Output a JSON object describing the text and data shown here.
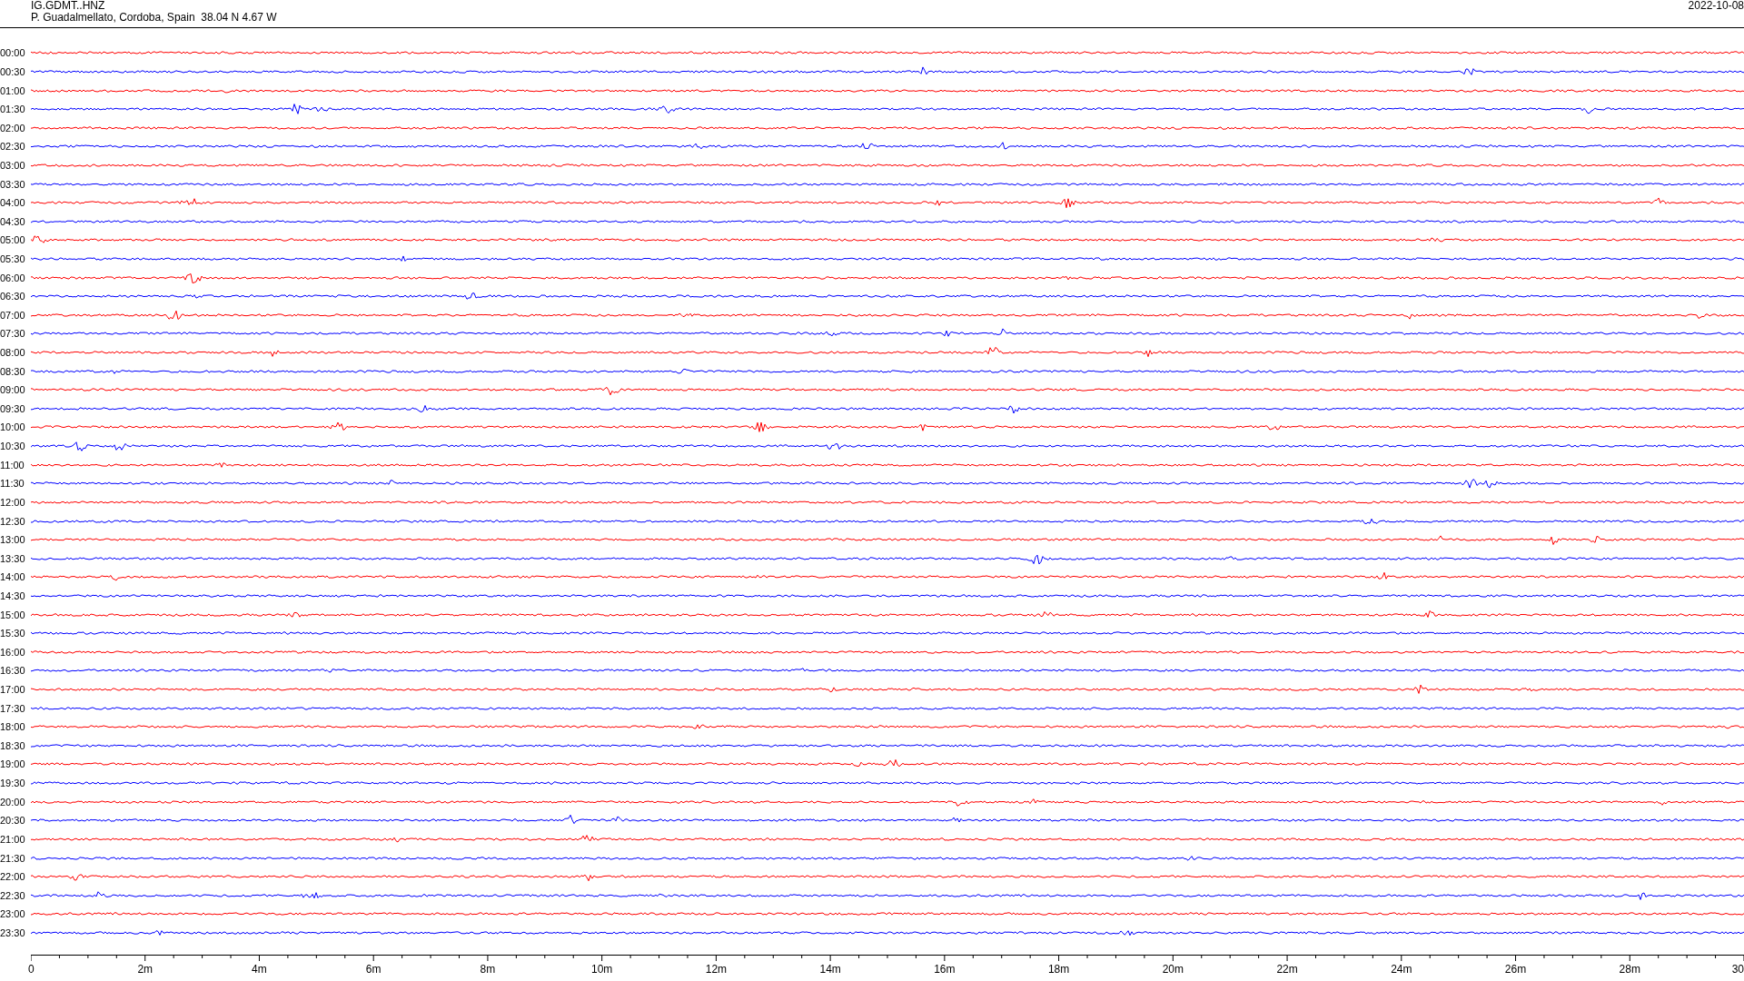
{
  "header": {
    "station": "IG.GDMT..HNZ",
    "location": "P. Guadalmellato, Cordoba, Spain  38.04 N 4.67 W",
    "date": "2022-10-08"
  },
  "rows": [
    {
      "time": "00:00",
      "color": "#ff0000"
    },
    {
      "time": "00:30",
      "color": "#0000ff"
    },
    {
      "time": "01:00",
      "color": "#ff0000"
    },
    {
      "time": "01:30",
      "color": "#0000ff"
    },
    {
      "time": "02:00",
      "color": "#ff0000"
    },
    {
      "time": "02:30",
      "color": "#0000ff"
    },
    {
      "time": "03:00",
      "color": "#ff0000"
    },
    {
      "time": "03:30",
      "color": "#0000ff"
    },
    {
      "time": "04:00",
      "color": "#ff0000"
    },
    {
      "time": "04:30",
      "color": "#0000ff"
    },
    {
      "time": "05:00",
      "color": "#ff0000"
    },
    {
      "time": "05:30",
      "color": "#0000ff"
    },
    {
      "time": "06:00",
      "color": "#ff0000"
    },
    {
      "time": "06:30",
      "color": "#0000ff"
    },
    {
      "time": "07:00",
      "color": "#ff0000"
    },
    {
      "time": "07:30",
      "color": "#0000ff"
    },
    {
      "time": "08:00",
      "color": "#ff0000"
    },
    {
      "time": "08:30",
      "color": "#0000ff"
    },
    {
      "time": "09:00",
      "color": "#ff0000"
    },
    {
      "time": "09:30",
      "color": "#0000ff"
    },
    {
      "time": "10:00",
      "color": "#ff0000"
    },
    {
      "time": "10:30",
      "color": "#0000ff"
    },
    {
      "time": "11:00",
      "color": "#ff0000"
    },
    {
      "time": "11:30",
      "color": "#0000ff"
    },
    {
      "time": "12:00",
      "color": "#ff0000"
    },
    {
      "time": "12:30",
      "color": "#0000ff"
    },
    {
      "time": "13:00",
      "color": "#ff0000"
    },
    {
      "time": "13:30",
      "color": "#0000ff"
    },
    {
      "time": "14:00",
      "color": "#ff0000"
    },
    {
      "time": "14:30",
      "color": "#0000ff"
    },
    {
      "time": "15:00",
      "color": "#ff0000"
    },
    {
      "time": "15:30",
      "color": "#0000ff"
    },
    {
      "time": "16:00",
      "color": "#ff0000"
    },
    {
      "time": "16:30",
      "color": "#0000ff"
    },
    {
      "time": "17:00",
      "color": "#ff0000"
    },
    {
      "time": "17:30",
      "color": "#0000ff"
    },
    {
      "time": "18:00",
      "color": "#ff0000"
    },
    {
      "time": "18:30",
      "color": "#0000ff"
    },
    {
      "time": "19:00",
      "color": "#ff0000"
    },
    {
      "time": "19:30",
      "color": "#0000ff"
    },
    {
      "time": "20:00",
      "color": "#ff0000"
    },
    {
      "time": "20:30",
      "color": "#0000ff"
    },
    {
      "time": "21:00",
      "color": "#ff0000"
    },
    {
      "time": "21:30",
      "color": "#0000ff"
    },
    {
      "time": "22:00",
      "color": "#ff0000"
    },
    {
      "time": "22:30",
      "color": "#0000ff"
    },
    {
      "time": "23:00",
      "color": "#ff0000"
    },
    {
      "time": "23:30",
      "color": "#0000ff"
    }
  ],
  "x_axis": {
    "labels": [
      "0",
      "2m",
      "4m",
      "6m",
      "8m",
      "10m",
      "12m",
      "14m",
      "16m",
      "18m",
      "20m",
      "22m",
      "24m",
      "26m",
      "28m",
      "30"
    ]
  }
}
